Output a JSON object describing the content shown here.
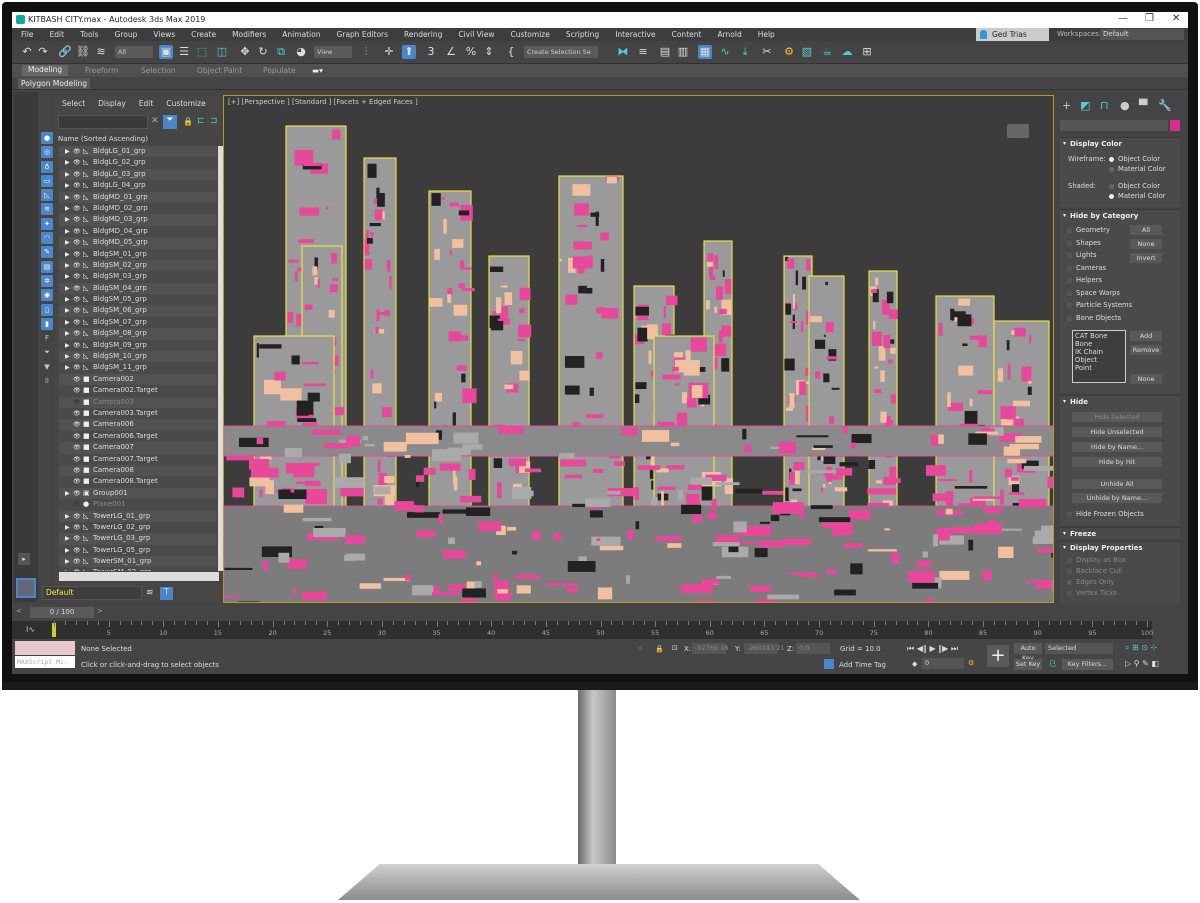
{
  "window": {
    "title": "KITBASH CITY.max - Autodesk 3ds Max 2019",
    "controls": [
      "—",
      "❐",
      "✕"
    ]
  },
  "menu": [
    "File",
    "Edit",
    "Tools",
    "Group",
    "Views",
    "Create",
    "Modifiers",
    "Animation",
    "Graph Editors",
    "Rendering",
    "Civil View",
    "Customize",
    "Scripting",
    "Interactive",
    "Content",
    "Arnold",
    "Help"
  ],
  "user": "Ged Trias",
  "workspaces": {
    "label": "Workspaces:",
    "value": "Default"
  },
  "toolbar": {
    "filter": "All",
    "refcoord": "View",
    "selection_set": "Create Selection Se"
  },
  "ribbon": {
    "tabs": [
      "Modeling",
      "Freeform",
      "Selection",
      "Object Paint",
      "Populate"
    ],
    "active": "Modeling",
    "panel": "Polygon Modeling"
  },
  "explorer": {
    "menu": [
      "Select",
      "Display",
      "Edit",
      "Customize"
    ],
    "header": "Name (Sorted Ascending)",
    "items": [
      {
        "name": "BldgLG_01_grp",
        "type": "geometry",
        "expand": true
      },
      {
        "name": "BldgLG_02_grp",
        "type": "geometry",
        "expand": true
      },
      {
        "name": "BldgLG_03_grp",
        "type": "geometry",
        "expand": true
      },
      {
        "name": "BldgLG_04_grp",
        "type": "geometry",
        "expand": true
      },
      {
        "name": "BldgMD_01_grp",
        "type": "geometry",
        "expand": true
      },
      {
        "name": "BldgMD_02_grp",
        "type": "geometry",
        "expand": true
      },
      {
        "name": "BldgMD_03_grp",
        "type": "geometry",
        "expand": true
      },
      {
        "name": "BldgMD_04_grp",
        "type": "geometry",
        "expand": true
      },
      {
        "name": "BldgMD_05_grp",
        "type": "geometry",
        "expand": true
      },
      {
        "name": "BldgSM_01_grp",
        "type": "geometry",
        "expand": true
      },
      {
        "name": "BldgSM_02_grp",
        "type": "geometry",
        "expand": true
      },
      {
        "name": "BldgSM_03_grp",
        "type": "geometry",
        "expand": true
      },
      {
        "name": "BldgSM_04_grp",
        "type": "geometry",
        "expand": true
      },
      {
        "name": "BldgSM_05_grp",
        "type": "geometry",
        "expand": true
      },
      {
        "name": "BldgSM_06_grp",
        "type": "geometry",
        "expand": true
      },
      {
        "name": "BldgSM_07_grp",
        "type": "geometry",
        "expand": true
      },
      {
        "name": "BldgSM_08_grp",
        "type": "geometry",
        "expand": true
      },
      {
        "name": "BldgSM_09_grp",
        "type": "geometry",
        "expand": true
      },
      {
        "name": "BldgSM_10_grp",
        "type": "geometry",
        "expand": true
      },
      {
        "name": "BldgSM_11_grp",
        "type": "geometry",
        "expand": true
      },
      {
        "name": "Camera002",
        "type": "camera"
      },
      {
        "name": "Camera002.Target",
        "type": "camera"
      },
      {
        "name": "Camera003",
        "type": "camera",
        "hidden": true
      },
      {
        "name": "Camera003.Target",
        "type": "camera"
      },
      {
        "name": "Camera006",
        "type": "camera"
      },
      {
        "name": "Camera006.Target",
        "type": "camera"
      },
      {
        "name": "Camera007",
        "type": "camera"
      },
      {
        "name": "Camera007.Target",
        "type": "camera"
      },
      {
        "name": "Camera008",
        "type": "camera"
      },
      {
        "name": "Camera008.Target",
        "type": "camera"
      },
      {
        "name": "Group001",
        "type": "group",
        "expand": true
      },
      {
        "name": "Plane001",
        "type": "plane",
        "hidden": true
      },
      {
        "name": "TowerLG_01_grp",
        "type": "geometry",
        "expand": true
      },
      {
        "name": "TowerLG_02_grp",
        "type": "geometry",
        "expand": true
      },
      {
        "name": "TowerLG_03_grp",
        "type": "geometry",
        "expand": true
      },
      {
        "name": "TowerLG_05_grp",
        "type": "geometry",
        "expand": true
      },
      {
        "name": "TowerSM_01_grp",
        "type": "geometry",
        "expand": true
      },
      {
        "name": "TowerSM_02_grp",
        "type": "geometry",
        "expand": true
      }
    ],
    "layer": "Default"
  },
  "viewport": {
    "label": "[+] [Perspective ] [Standard ] [Facets + Edged Faces ]",
    "colors": {
      "bg": "#3c3c3c",
      "mesh": "#9a9a9a",
      "edges": "#e8489a",
      "selection": "#e8e040",
      "accent": "#f0c0a0"
    }
  },
  "command_panel": {
    "object_color": "#d6308c",
    "display_color": {
      "title": "Display Color",
      "wireframe_label": "Wireframe:",
      "shaded_label": "Shaded:",
      "object_color": "Object Color",
      "material_color": "Material Color",
      "wireframe_selected": "Object Color",
      "shaded_selected": "Material Color"
    },
    "hide_by_category": {
      "title": "Hide by Category",
      "categories": [
        "Geometry",
        "Shapes",
        "Lights",
        "Cameras",
        "Helpers",
        "Space Warps",
        "Particle Systems",
        "Bone Objects"
      ],
      "buttons": [
        "All",
        "None",
        "Invert"
      ],
      "list": [
        "CAT Bone",
        "Bone",
        "IK Chain Object",
        "Point"
      ],
      "list_buttons": [
        "Add",
        "Remove",
        "None"
      ]
    },
    "hide": {
      "title": "Hide",
      "buttons": [
        "Hide Selected",
        "Hide Unselected",
        "Hide by Name...",
        "Hide by Hit",
        "Unhide All",
        "Unhide by Name..."
      ],
      "checkbox": "Hide Frozen Objects"
    },
    "freeze": {
      "title": "Freeze"
    },
    "display_properties": {
      "title": "Display Properties",
      "options": [
        {
          "label": "Display as Box",
          "checked": false
        },
        {
          "label": "Backface Cull",
          "checked": false
        },
        {
          "label": "Edges Only",
          "checked": true
        },
        {
          "label": "Vertex Ticks",
          "checked": false
        }
      ]
    }
  },
  "timeline": {
    "slider": "0 / 100",
    "current_frame": 0,
    "ticks": [
      "5",
      "10",
      "15",
      "20",
      "25",
      "30",
      "35",
      "40",
      "45",
      "50",
      "55",
      "60",
      "65",
      "70",
      "75",
      "80",
      "85",
      "90",
      "95",
      "100"
    ]
  },
  "status": {
    "selection": "None Selected",
    "prompt": "Click or click-and-drag to select objects",
    "maxscript": "MAXScript Mi:",
    "x_label": "X:",
    "x": "-92769.18",
    "y_label": "Y:",
    "y": "-260243.21",
    "z_label": "Z:",
    "z": "0.0",
    "grid": "Grid = 10.0",
    "add_time_tag": "Add Time Tag",
    "frame": "0",
    "auto_key": "Auto Key",
    "set_key": "Set Key",
    "key_mode": "Selected",
    "key_filters": "Key Filters..."
  }
}
